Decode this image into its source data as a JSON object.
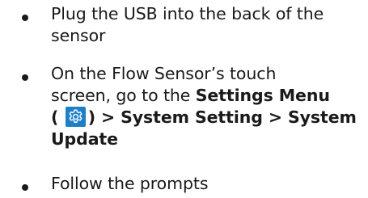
{
  "steps": [
    {
      "line1": "Plug the USB into the back of the",
      "line2": "sensor"
    },
    {
      "line1": "On the Flow Sensor’s touch",
      "line2": "screen, go to the ",
      "settings_menu": "Settings Menu",
      "open_paren": "(",
      "gear_icon": "gear-icon",
      "close_path": ") > System Setting > System",
      "update": "Update"
    },
    {
      "line1": "Follow the prompts"
    }
  ],
  "colors": {
    "text": "#1a1a1a",
    "gear_background": "#1e7fc7",
    "gear_foreground": "#ffffff"
  }
}
